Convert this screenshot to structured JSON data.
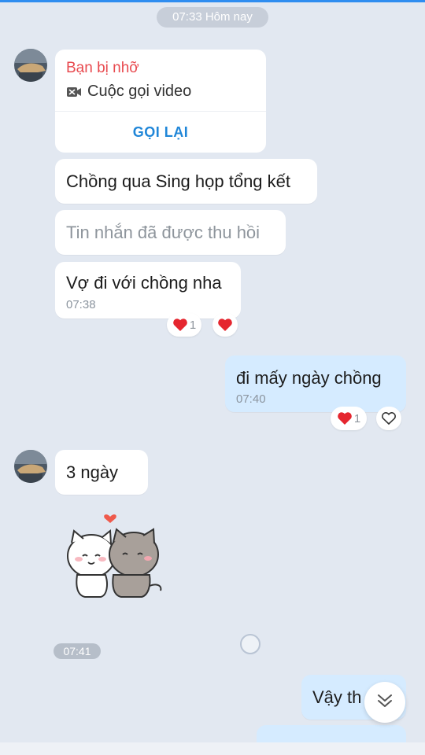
{
  "header": {
    "date_label": "07:33 Hôm nay"
  },
  "missed_call": {
    "title": "Bạn bị nhỡ",
    "subtitle": "Cuộc gọi video",
    "action": "GỌI LẠI"
  },
  "messages": [
    {
      "side": "in",
      "text": "Chồng qua Sing họp tổng kết"
    },
    {
      "side": "in",
      "text": "Tin nhắn đã được thu hồi"
    },
    {
      "side": "in",
      "text": "Vợ đi với chồng nha",
      "time": "07:38",
      "reaction_count": "1"
    },
    {
      "side": "out",
      "text": "đi mấy ngày chồng",
      "time": "07:40",
      "reaction_count": "1"
    },
    {
      "side": "in",
      "text": "3 ngày"
    },
    {
      "side": "out",
      "text": "Vậy th"
    }
  ],
  "sticker": {
    "time": "07:41"
  },
  "icons": {
    "reaction": "heart-icon",
    "add_reaction": "heart-outline-icon",
    "video": "video-camera-icon",
    "scroll_down": "double-chevron-down-icon"
  },
  "colors": {
    "background": "#e2e8f1",
    "outgoing_bubble": "#d5ebff",
    "missed_title": "#e84a4f",
    "link": "#1f86d8",
    "heart": "#e5262f"
  }
}
